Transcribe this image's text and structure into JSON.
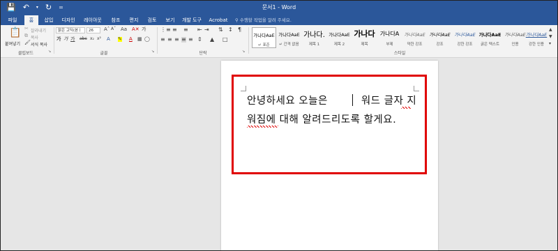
{
  "title": "문서1 - Word",
  "qat": {
    "save_icon": "save-icon",
    "undo_icon": "undo-icon",
    "redo_icon": "redo-icon",
    "customize": "="
  },
  "tabs": [
    "파일",
    "홈",
    "삽입",
    "디자인",
    "레이아웃",
    "참조",
    "편지",
    "검토",
    "보기",
    "개발 도구",
    "Acrobat"
  ],
  "active_tab": "홈",
  "tell_me": "수행할 작업을 알려 주세요.",
  "clipboard": {
    "paste": "붙여넣기",
    "cut": "잘라내기",
    "copy": "복사",
    "format_painter": "서식 복사",
    "label": "클립보드"
  },
  "font": {
    "name": "맑은 고딕(본ㅣ",
    "size": "26",
    "label": "글꼴"
  },
  "paragraph": {
    "label": "단락"
  },
  "styles": {
    "label": "스타일",
    "items": [
      {
        "sample": "가나다AaE",
        "name": "↵ 표준"
      },
      {
        "sample": "가나다AaE",
        "name": "↵ 간격 없음"
      },
      {
        "sample": "가나다.",
        "name": "제목 1"
      },
      {
        "sample": "가나다AaE",
        "name": "제목 2"
      },
      {
        "sample": "가나다",
        "name": "제목"
      },
      {
        "sample": "가나다A",
        "name": "부제"
      },
      {
        "sample": "가나다AaE",
        "name": "약한 강조"
      },
      {
        "sample": "가나다AaE",
        "name": "강조"
      },
      {
        "sample": "가나다AaE",
        "name": "강한 강조"
      },
      {
        "sample": "가나다AaE",
        "name": "굵은 텍스트"
      },
      {
        "sample": "가나다AaE",
        "name": "인용"
      },
      {
        "sample": "가나다AaE",
        "name": "강한 인용"
      },
      {
        "sample": "가나다AaE",
        "name": "약한 참조"
      }
    ]
  },
  "document": {
    "line1_a": "안녕하세요 오늘은",
    "line1_b": "워드 글자 지",
    "line2": "워짐에 대해 알려드리도록 할게요."
  },
  "colors": {
    "titlebar": "#2b579a",
    "highlight": "#e00000",
    "ribbon": "#f3f3f3",
    "workspace": "#e6e6e6"
  }
}
